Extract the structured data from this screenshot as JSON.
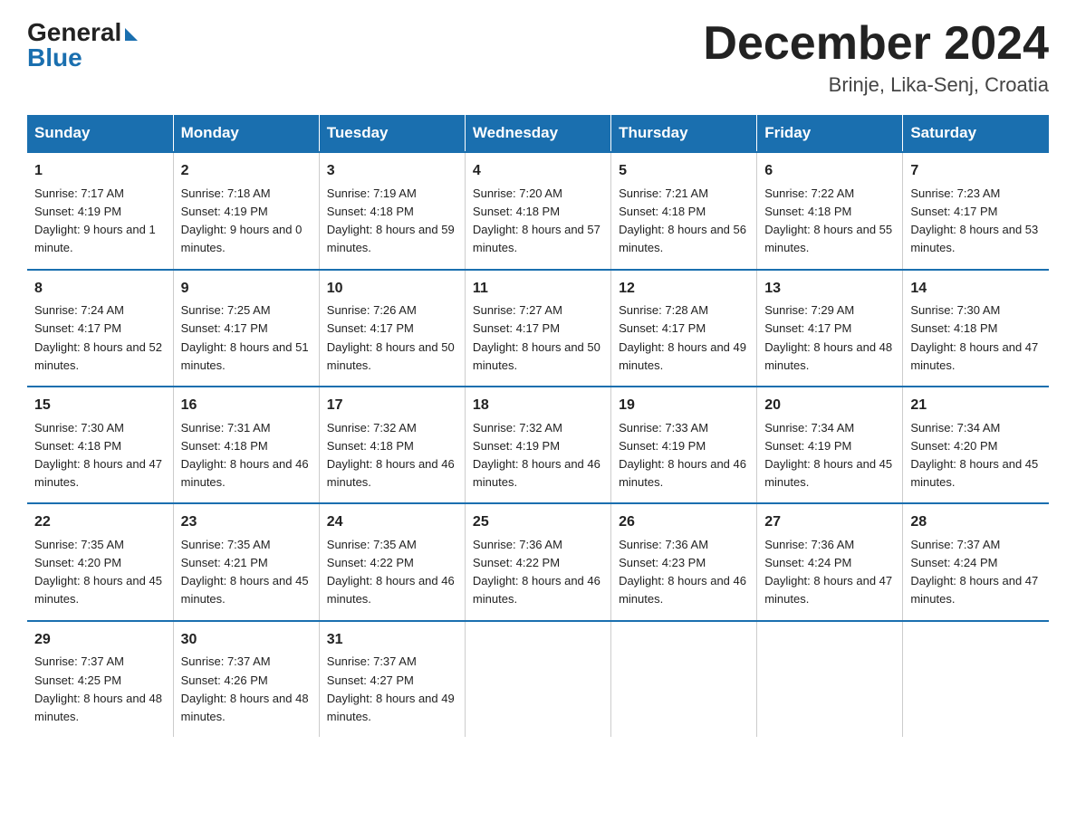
{
  "logo": {
    "general": "General",
    "blue": "Blue"
  },
  "title": "December 2024",
  "location": "Brinje, Lika-Senj, Croatia",
  "days_of_week": [
    "Sunday",
    "Monday",
    "Tuesday",
    "Wednesday",
    "Thursday",
    "Friday",
    "Saturday"
  ],
  "weeks": [
    [
      {
        "day": "1",
        "sunrise": "7:17 AM",
        "sunset": "4:19 PM",
        "daylight": "9 hours and 1 minute."
      },
      {
        "day": "2",
        "sunrise": "7:18 AM",
        "sunset": "4:19 PM",
        "daylight": "9 hours and 0 minutes."
      },
      {
        "day": "3",
        "sunrise": "7:19 AM",
        "sunset": "4:18 PM",
        "daylight": "8 hours and 59 minutes."
      },
      {
        "day": "4",
        "sunrise": "7:20 AM",
        "sunset": "4:18 PM",
        "daylight": "8 hours and 57 minutes."
      },
      {
        "day": "5",
        "sunrise": "7:21 AM",
        "sunset": "4:18 PM",
        "daylight": "8 hours and 56 minutes."
      },
      {
        "day": "6",
        "sunrise": "7:22 AM",
        "sunset": "4:18 PM",
        "daylight": "8 hours and 55 minutes."
      },
      {
        "day": "7",
        "sunrise": "7:23 AM",
        "sunset": "4:17 PM",
        "daylight": "8 hours and 53 minutes."
      }
    ],
    [
      {
        "day": "8",
        "sunrise": "7:24 AM",
        "sunset": "4:17 PM",
        "daylight": "8 hours and 52 minutes."
      },
      {
        "day": "9",
        "sunrise": "7:25 AM",
        "sunset": "4:17 PM",
        "daylight": "8 hours and 51 minutes."
      },
      {
        "day": "10",
        "sunrise": "7:26 AM",
        "sunset": "4:17 PM",
        "daylight": "8 hours and 50 minutes."
      },
      {
        "day": "11",
        "sunrise": "7:27 AM",
        "sunset": "4:17 PM",
        "daylight": "8 hours and 50 minutes."
      },
      {
        "day": "12",
        "sunrise": "7:28 AM",
        "sunset": "4:17 PM",
        "daylight": "8 hours and 49 minutes."
      },
      {
        "day": "13",
        "sunrise": "7:29 AM",
        "sunset": "4:17 PM",
        "daylight": "8 hours and 48 minutes."
      },
      {
        "day": "14",
        "sunrise": "7:30 AM",
        "sunset": "4:18 PM",
        "daylight": "8 hours and 47 minutes."
      }
    ],
    [
      {
        "day": "15",
        "sunrise": "7:30 AM",
        "sunset": "4:18 PM",
        "daylight": "8 hours and 47 minutes."
      },
      {
        "day": "16",
        "sunrise": "7:31 AM",
        "sunset": "4:18 PM",
        "daylight": "8 hours and 46 minutes."
      },
      {
        "day": "17",
        "sunrise": "7:32 AM",
        "sunset": "4:18 PM",
        "daylight": "8 hours and 46 minutes."
      },
      {
        "day": "18",
        "sunrise": "7:32 AM",
        "sunset": "4:19 PM",
        "daylight": "8 hours and 46 minutes."
      },
      {
        "day": "19",
        "sunrise": "7:33 AM",
        "sunset": "4:19 PM",
        "daylight": "8 hours and 46 minutes."
      },
      {
        "day": "20",
        "sunrise": "7:34 AM",
        "sunset": "4:19 PM",
        "daylight": "8 hours and 45 minutes."
      },
      {
        "day": "21",
        "sunrise": "7:34 AM",
        "sunset": "4:20 PM",
        "daylight": "8 hours and 45 minutes."
      }
    ],
    [
      {
        "day": "22",
        "sunrise": "7:35 AM",
        "sunset": "4:20 PM",
        "daylight": "8 hours and 45 minutes."
      },
      {
        "day": "23",
        "sunrise": "7:35 AM",
        "sunset": "4:21 PM",
        "daylight": "8 hours and 45 minutes."
      },
      {
        "day": "24",
        "sunrise": "7:35 AM",
        "sunset": "4:22 PM",
        "daylight": "8 hours and 46 minutes."
      },
      {
        "day": "25",
        "sunrise": "7:36 AM",
        "sunset": "4:22 PM",
        "daylight": "8 hours and 46 minutes."
      },
      {
        "day": "26",
        "sunrise": "7:36 AM",
        "sunset": "4:23 PM",
        "daylight": "8 hours and 46 minutes."
      },
      {
        "day": "27",
        "sunrise": "7:36 AM",
        "sunset": "4:24 PM",
        "daylight": "8 hours and 47 minutes."
      },
      {
        "day": "28",
        "sunrise": "7:37 AM",
        "sunset": "4:24 PM",
        "daylight": "8 hours and 47 minutes."
      }
    ],
    [
      {
        "day": "29",
        "sunrise": "7:37 AM",
        "sunset": "4:25 PM",
        "daylight": "8 hours and 48 minutes."
      },
      {
        "day": "30",
        "sunrise": "7:37 AM",
        "sunset": "4:26 PM",
        "daylight": "8 hours and 48 minutes."
      },
      {
        "day": "31",
        "sunrise": "7:37 AM",
        "sunset": "4:27 PM",
        "daylight": "8 hours and 49 minutes."
      },
      null,
      null,
      null,
      null
    ]
  ],
  "labels": {
    "sunrise_prefix": "Sunrise: ",
    "sunset_prefix": "Sunset: ",
    "daylight_prefix": "Daylight: "
  }
}
